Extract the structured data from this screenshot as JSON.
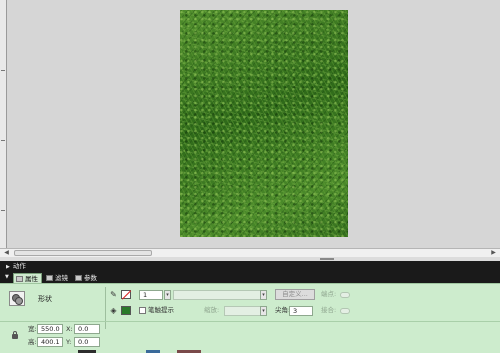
{
  "panels": {
    "actions_title": "动作",
    "tabs": [
      {
        "label": "属性",
        "active": true
      },
      {
        "label": "滤镜",
        "active": false
      },
      {
        "label": "参数",
        "active": false
      }
    ]
  },
  "properties": {
    "shape_type": "形状",
    "stroke_height": "1",
    "custom_button": "自定义...",
    "cap_label": "端点:",
    "stroke_hint_label": "笔触提示",
    "scale_label": "缩放:",
    "miter_label": "尖角:",
    "miter_value": "3",
    "join_label": "接合:",
    "width_label": "宽:",
    "width_value": "550.0",
    "height_label": "高:",
    "height_value": "400.1",
    "x_label": "X:",
    "x_value": "0.0",
    "y_label": "Y:",
    "y_value": "0.0"
  },
  "colors": {
    "panel_bg": "#cdeccd",
    "header_bg": "#1a1a1a",
    "stage_bg": "#d6d6d6",
    "fill_color": "#2a7a2a",
    "stroke_none_mark": "#d22222"
  },
  "icons": {
    "pencil": "pencil-icon",
    "bucket": "paint-bucket-icon",
    "shape": "shape-icon",
    "lock": "lock-icon"
  }
}
